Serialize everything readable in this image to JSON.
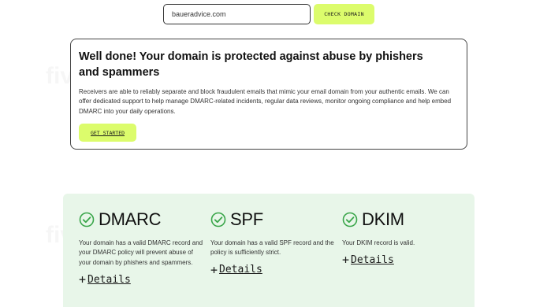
{
  "watermark_text": "fiverr.",
  "search": {
    "value": "baueradvice.com",
    "button_label": "CHECK DOMAIN"
  },
  "result": {
    "title": "Well done! Your domain is protected against abuse by phishers and spammers",
    "body": "Receivers are able to reliably separate and block fraudulent emails that mimic your email domain from your authentic emails. We can offer dedicated support to help manage DMARC-related incidents, regular data reviews, monitor ongoing compliance and help embed DMARC into your daily operations.",
    "cta_label": "GET STARTED"
  },
  "checks": [
    {
      "name": "DMARC",
      "icon": "check-circle-icon",
      "description": "Your domain has a valid DMARC record and your DMARC policy will prevent abuse of your domain by phishers and spammers.",
      "details_label": "Details"
    },
    {
      "name": "SPF",
      "icon": "check-circle-icon",
      "description": "Your domain has a valid SPF record and the policy is sufficiently strict.",
      "details_label": "Details"
    },
    {
      "name": "DKIM",
      "icon": "check-circle-icon",
      "description": "Your DKIM record is valid.",
      "details_label": "Details"
    }
  ],
  "colors": {
    "accent": "#dcfc6c",
    "panel_bg": "#e8f6e9",
    "check_green": "#3aa64a"
  }
}
